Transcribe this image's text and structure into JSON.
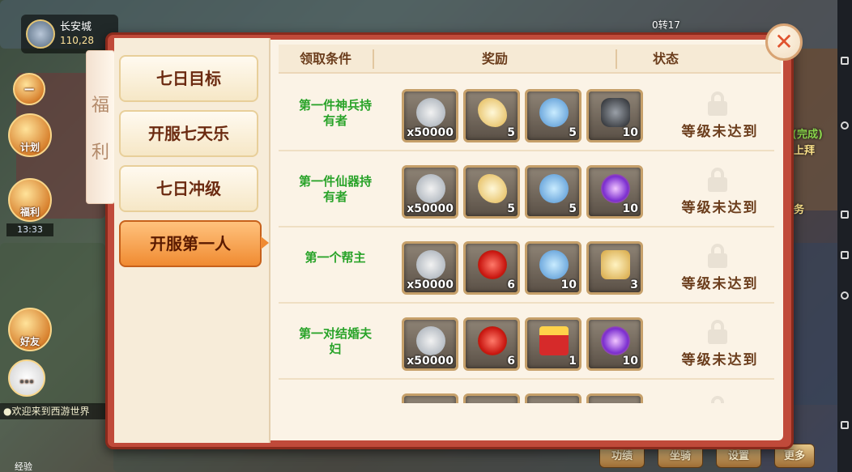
{
  "hud": {
    "city_name": "长安城",
    "city_coords": "110,28",
    "side_buttons": [
      "福利",
      "好友"
    ],
    "top_left_label": "书",
    "side_btn_extra": "计划",
    "timer": "13:33",
    "chat_text": "●欢迎来到西游世界",
    "right_texts": [
      "(完成)",
      "上拜",
      "务"
    ],
    "map_text": "0转17",
    "bottom_buttons": [
      "功绩",
      "坐骑",
      "设置",
      "更多"
    ],
    "exp_label": "经验"
  },
  "modal": {
    "ribbon_chars": [
      "福",
      "利"
    ],
    "tabs": [
      {
        "label": "七日目标",
        "active": false
      },
      {
        "label": "开服七天乐",
        "active": false
      },
      {
        "label": "七日冲级",
        "active": false
      },
      {
        "label": "开服第一人",
        "active": true
      }
    ],
    "headers": {
      "condition": "领取条件",
      "reward": "奖励",
      "status": "状态"
    },
    "rows": [
      {
        "condition": "第一件神兵持有者",
        "items": [
          {
            "icon": "silver-coin-icon",
            "qty": "x50000"
          },
          {
            "icon": "gold-feather-icon",
            "qty": "5"
          },
          {
            "icon": "jade-vase-icon",
            "qty": "5"
          },
          {
            "icon": "dark-ore-icon",
            "qty": "10"
          }
        ],
        "status": "等级未达到"
      },
      {
        "condition": "第一件仙器持有者",
        "items": [
          {
            "icon": "silver-coin-icon",
            "qty": "x50000"
          },
          {
            "icon": "gold-feather-icon",
            "qty": "5"
          },
          {
            "icon": "jade-vase-icon",
            "qty": "5"
          },
          {
            "icon": "purple-orb-icon",
            "qty": "10"
          }
        ],
        "status": "等级未达到"
      },
      {
        "condition": "第一个帮主",
        "items": [
          {
            "icon": "silver-coin-icon",
            "qty": "x50000"
          },
          {
            "icon": "red-rose-icon",
            "qty": "6"
          },
          {
            "icon": "jade-vase-icon",
            "qty": "10"
          },
          {
            "icon": "gold-scroll-icon",
            "qty": "3"
          }
        ],
        "status": "等级未达到"
      },
      {
        "condition": "第一对结婚夫妇",
        "items": [
          {
            "icon": "silver-coin-icon",
            "qty": "x50000"
          },
          {
            "icon": "red-rose-icon",
            "qty": "6"
          },
          {
            "icon": "gift-box-icon",
            "qty": "1"
          },
          {
            "icon": "purple-orb-icon",
            "qty": "10"
          }
        ],
        "status": "等级未达到"
      }
    ],
    "colors": {
      "frame": "#c04a3a",
      "active_tab": "#f08b32",
      "condition_text": "#29a329",
      "status_text": "#6b3d1c"
    }
  }
}
